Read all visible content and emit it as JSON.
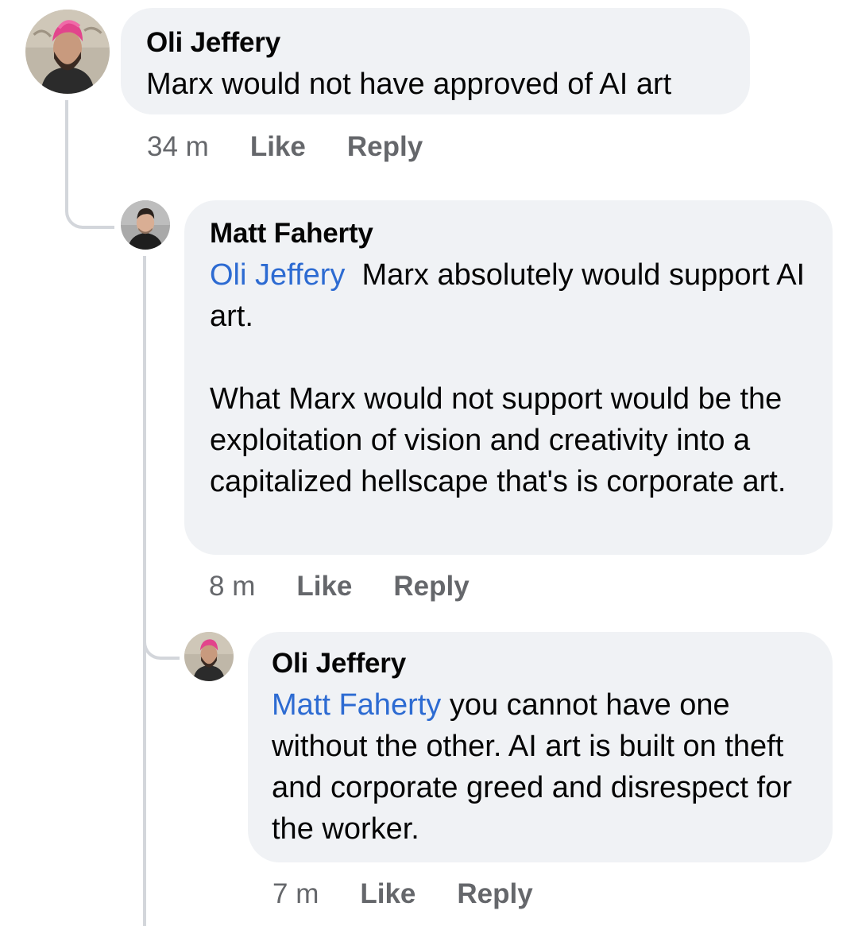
{
  "comments": [
    {
      "author": "Oli Jeffery",
      "mention": "",
      "paragraphs": [
        "Marx would not have approved of AI art"
      ],
      "time": "34 m",
      "like": "Like",
      "reply": "Reply"
    },
    {
      "author": "Matt Faherty",
      "mention": "Oli Jeffery",
      "first_text": "Marx absolutely would support AI art.",
      "second_paragraph": "What Marx would not support would be the exploitation of vision and creativity into a capitalized hellscape that's is corporate art.",
      "time": "8 m",
      "like": "Like",
      "reply": "Reply"
    },
    {
      "author": "Oli Jeffery",
      "mention": "Matt Faherty",
      "first_text": "you cannot have one without the other. AI art is built on theft and corporate greed and disrespect for the worker.",
      "time": "7 m",
      "like": "Like",
      "reply": "Reply"
    }
  ],
  "colors": {
    "bubble": "#f0f2f5",
    "mention": "#2d6bd2",
    "meta": "#65676b",
    "thread_line": "#d3d6db"
  },
  "icons": {
    "oli_avatar": "profile-photo-pink-hair-beard",
    "matt_avatar": "profile-photo-dark-hair"
  }
}
